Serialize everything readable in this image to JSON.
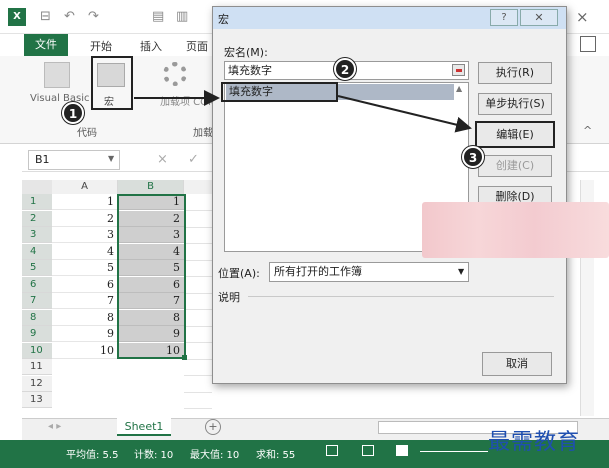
{
  "titlebar": {
    "logo": "X",
    "close": "×",
    "qa": [
      "⊟",
      "↶",
      "↷",
      "▤",
      "▥"
    ]
  },
  "ribbon": {
    "tabs": [
      "文件",
      "开始",
      "插入",
      "页面"
    ],
    "visual_basic": "Visual Basic",
    "macro": "宏",
    "code_group": "代码",
    "addin": "加载项 COM",
    "addin_group": "加载",
    "collapse": "^"
  },
  "formula": {
    "namebox": "B1",
    "cancel": "×",
    "confirm": "✓"
  },
  "grid": {
    "columns": [
      "A",
      "B"
    ],
    "rows": [
      "1",
      "2",
      "3",
      "4",
      "5",
      "6",
      "7",
      "8",
      "9",
      "10",
      "11",
      "12",
      "13"
    ],
    "colA": [
      "1",
      "2",
      "3",
      "4",
      "5",
      "6",
      "7",
      "8",
      "9",
      "10"
    ],
    "colB": [
      "1",
      "2",
      "3",
      "4",
      "5",
      "6",
      "7",
      "8",
      "9",
      "10"
    ]
  },
  "sheets": {
    "nav": "◂   ▸",
    "tab": "Sheet1",
    "add": "+"
  },
  "status": {
    "average": "平均值: 5.5",
    "count": "计数: 10",
    "max": "最大值: 10",
    "sum": "求和: 55"
  },
  "watermark": "最需教育",
  "dialog": {
    "title": "宏",
    "help": "?",
    "close": "✕",
    "name_label": "宏名(M):",
    "name_value": "填充数字",
    "list_item": "填充数字",
    "buttons": {
      "run": "执行(R)",
      "step": "单步执行(S)",
      "edit": "编辑(E)",
      "create": "创建(C)",
      "delete": "删除(D)",
      "cancel": "取消"
    },
    "location_label": "位置(A):",
    "location_value": "所有打开的工作簿",
    "description_label": "说明"
  },
  "steps": [
    "1",
    "2",
    "3"
  ],
  "colors": {
    "accent": "#217346",
    "dialog_title": "#cfe0f3",
    "selection": "#aeb8c7"
  }
}
